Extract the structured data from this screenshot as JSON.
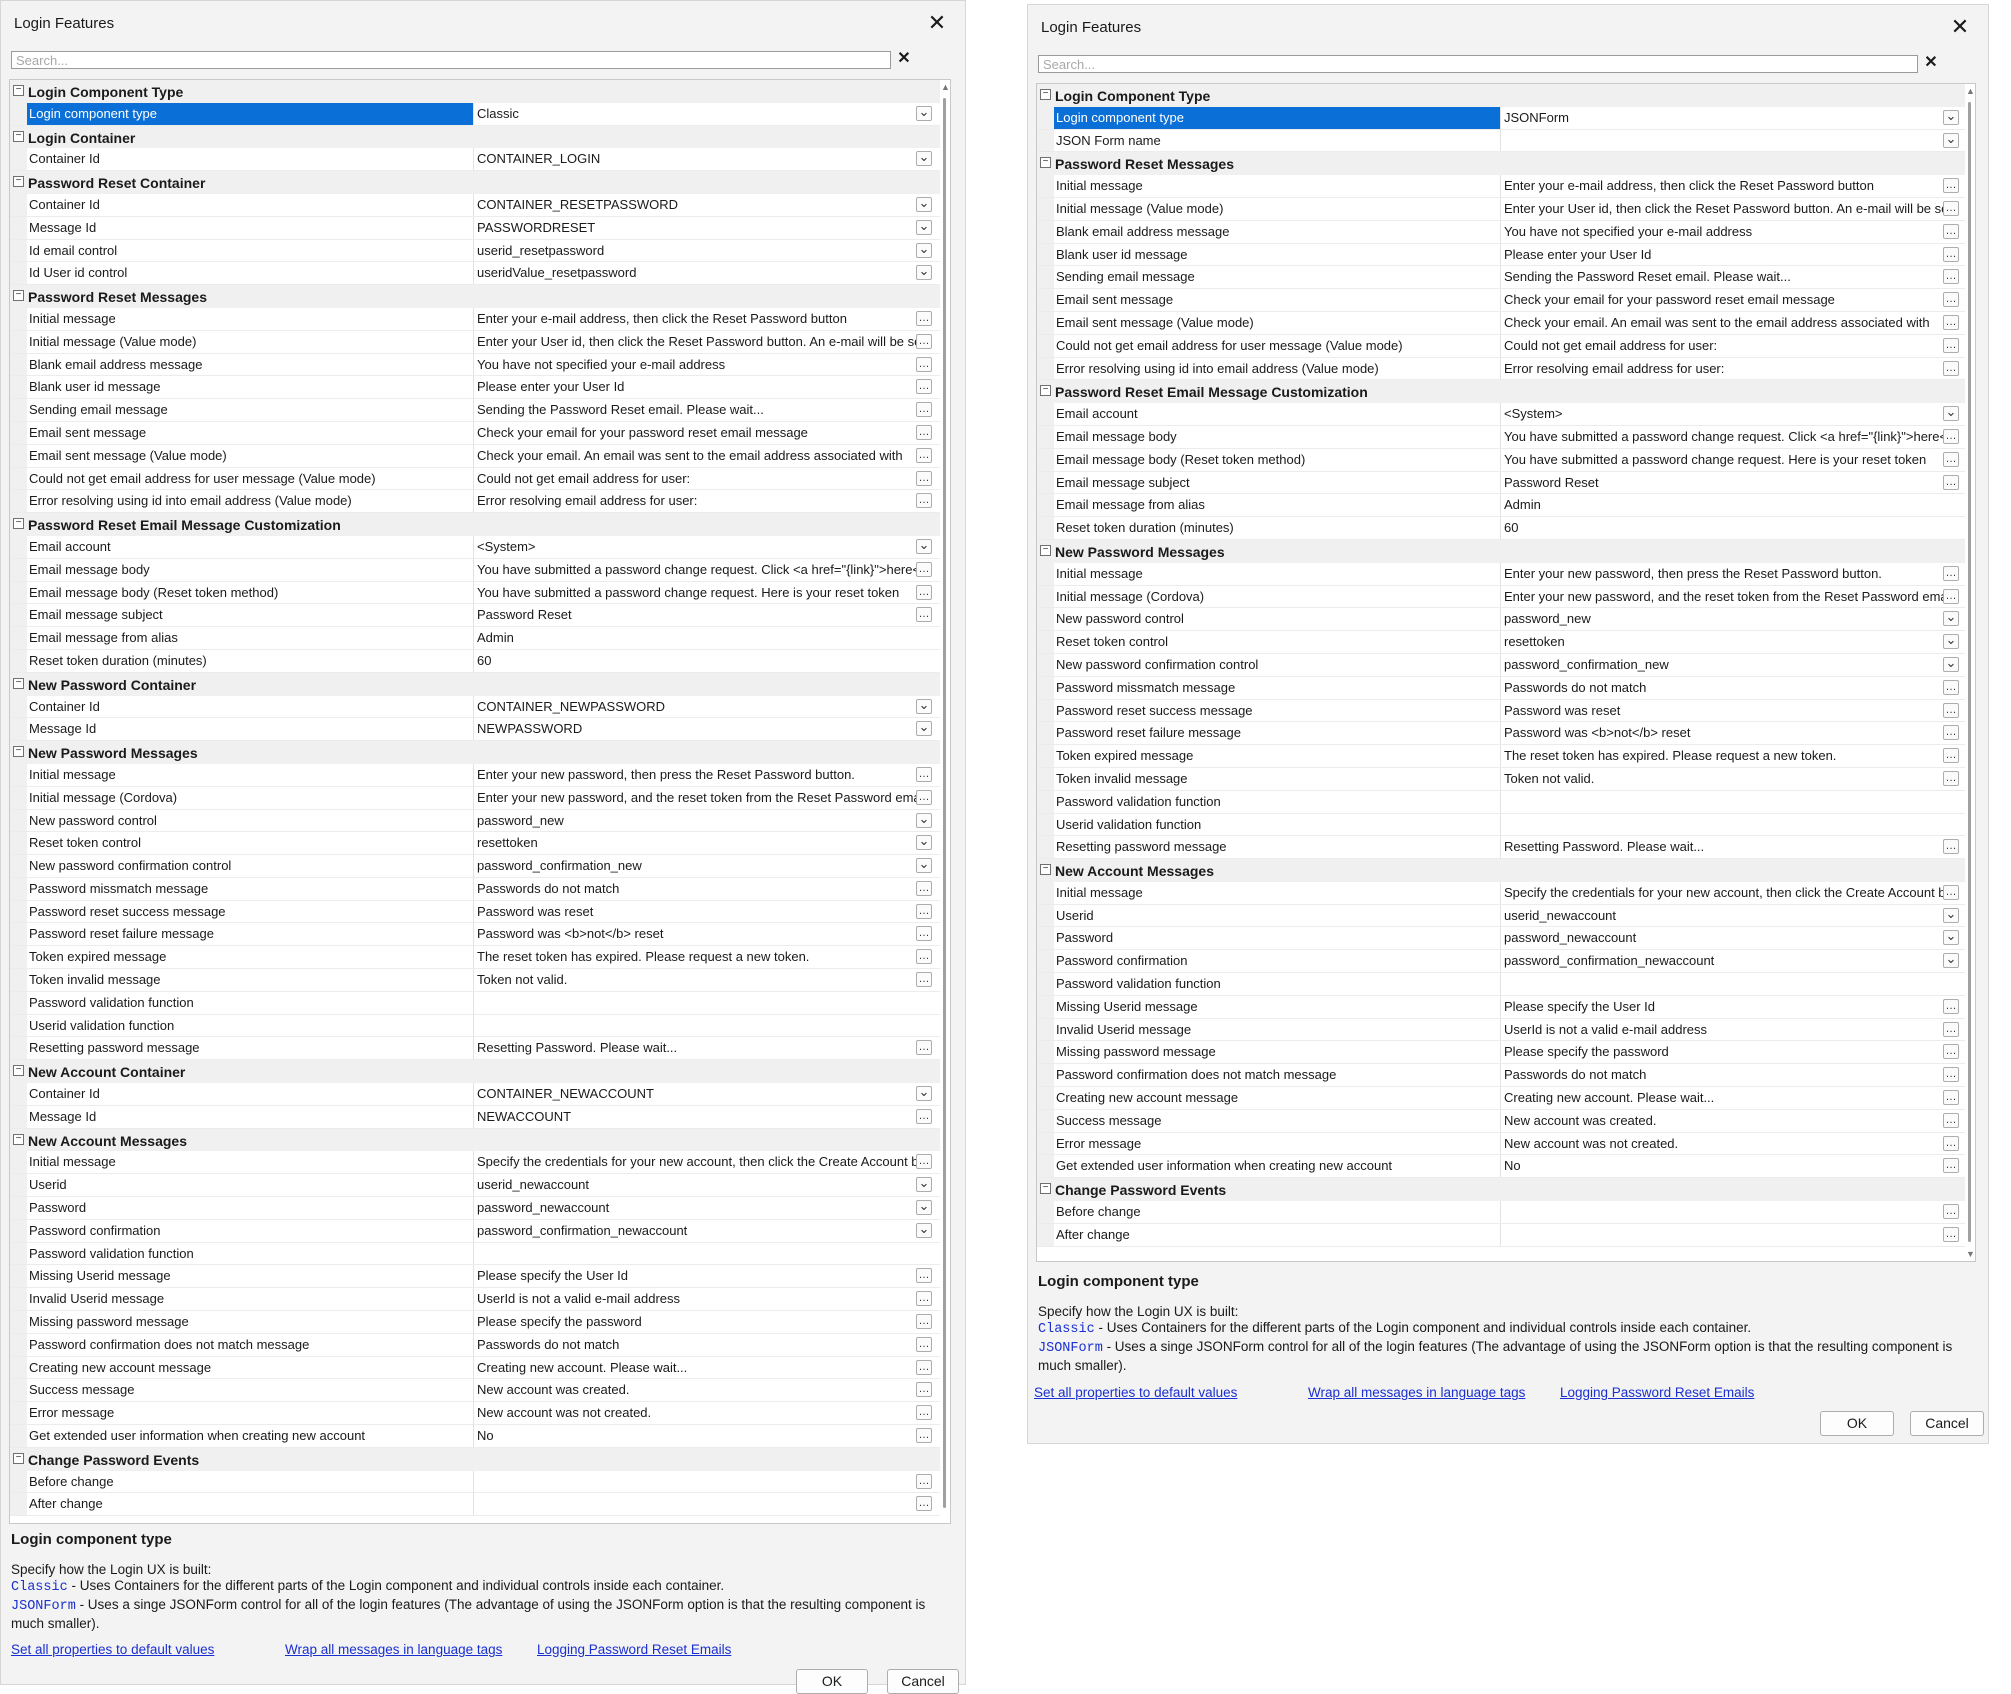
{
  "left": {
    "window_title": "Login Features",
    "search_placeholder": "Search...",
    "rows": [
      {
        "t": "c",
        "label": "Login Component Type"
      },
      {
        "t": "p",
        "name": "Login component type",
        "value": "Classic",
        "btn": "dd",
        "sel": true
      },
      {
        "t": "c",
        "label": "Login Container"
      },
      {
        "t": "p",
        "name": "Container Id",
        "value": "CONTAINER_LOGIN",
        "btn": "dd"
      },
      {
        "t": "c",
        "label": "Password Reset Container"
      },
      {
        "t": "p",
        "name": "Container Id",
        "value": "CONTAINER_RESETPASSWORD",
        "btn": "dd"
      },
      {
        "t": "p",
        "name": "Message Id",
        "value": "PASSWORDRESET",
        "btn": "dd"
      },
      {
        "t": "p",
        "name": "Id email control",
        "value": "userid_resetpassword",
        "btn": "dd"
      },
      {
        "t": "p",
        "name": "Id User id control",
        "value": "useridValue_resetpassword",
        "btn": "dd"
      },
      {
        "t": "c",
        "label": "Password Reset Messages"
      },
      {
        "t": "p",
        "name": "Initial message",
        "value": "Enter your e-mail address, then click the Reset Password button",
        "btn": "el"
      },
      {
        "t": "p",
        "name": "Initial message (Value mode)",
        "value": "Enter your User id, then click the Reset Password button. An e-mail will be sent",
        "btn": "el"
      },
      {
        "t": "p",
        "name": "Blank email address message",
        "value": "You have not specified your e-mail address",
        "btn": "el"
      },
      {
        "t": "p",
        "name": "Blank user id message",
        "value": "Please enter your User Id",
        "btn": "el"
      },
      {
        "t": "p",
        "name": "Sending email message",
        "value": "Sending the Password Reset email. Please wait...",
        "btn": "el"
      },
      {
        "t": "p",
        "name": "Email sent message",
        "value": "Check your email for your password reset email message",
        "btn": "el"
      },
      {
        "t": "p",
        "name": "Email sent message (Value mode)",
        "value": "Check your email. An email was sent to the email address associated with",
        "btn": "el"
      },
      {
        "t": "p",
        "name": "Could not get email address for user message (Value mode)",
        "value": "Could not get email address for user:",
        "btn": "el"
      },
      {
        "t": "p",
        "name": "Error resolving using id into email address (Value mode)",
        "value": "Error resolving email address for user:",
        "btn": "el"
      },
      {
        "t": "c",
        "label": "Password Reset Email Message Customization"
      },
      {
        "t": "p",
        "name": "Email account",
        "value": "<System>",
        "btn": "dd"
      },
      {
        "t": "p",
        "name": "Email message body",
        "value": "You have submitted a password change request. Click <a href=\"{link}\">here</a>",
        "btn": "el"
      },
      {
        "t": "p",
        "name": "Email message body (Reset token method)",
        "value": "You have submitted a password change request. Here is your reset token",
        "btn": "el"
      },
      {
        "t": "p",
        "name": "Email message subject",
        "value": "Password Reset",
        "btn": "el"
      },
      {
        "t": "p",
        "name": "Email message from alias",
        "value": "Admin",
        "btn": ""
      },
      {
        "t": "p",
        "name": "Reset token duration (minutes)",
        "value": "60",
        "btn": ""
      },
      {
        "t": "c",
        "label": "New Password Container"
      },
      {
        "t": "p",
        "name": "Container Id",
        "value": "CONTAINER_NEWPASSWORD",
        "btn": "dd"
      },
      {
        "t": "p",
        "name": "Message Id",
        "value": "NEWPASSWORD",
        "btn": "dd"
      },
      {
        "t": "c",
        "label": "New Password Messages"
      },
      {
        "t": "p",
        "name": "Initial message",
        "value": "Enter your new password, then press the Reset Password button.",
        "btn": "el"
      },
      {
        "t": "p",
        "name": "Initial message (Cordova)",
        "value": "Enter your new password, and the reset token from the Reset Password email",
        "btn": "el"
      },
      {
        "t": "p",
        "name": "New password control",
        "value": "password_new",
        "btn": "dd"
      },
      {
        "t": "p",
        "name": "Reset token control",
        "value": "resettoken",
        "btn": "dd"
      },
      {
        "t": "p",
        "name": "New password confirmation control",
        "value": "password_confirmation_new",
        "btn": "dd"
      },
      {
        "t": "p",
        "name": "Password missmatch message",
        "value": "Passwords do not match",
        "btn": "el"
      },
      {
        "t": "p",
        "name": "Password reset success message",
        "value": "Password was reset",
        "btn": "el"
      },
      {
        "t": "p",
        "name": "Password reset failure message",
        "value": "Password was <b>not</b> reset",
        "btn": "el"
      },
      {
        "t": "p",
        "name": "Token expired message",
        "value": "The reset token has expired. Please request a new token.",
        "btn": "el"
      },
      {
        "t": "p",
        "name": "Token invalid message",
        "value": "Token not valid.",
        "btn": "el"
      },
      {
        "t": "p",
        "name": "Password validation function",
        "value": "",
        "btn": ""
      },
      {
        "t": "p",
        "name": "Userid validation function",
        "value": "",
        "btn": ""
      },
      {
        "t": "p",
        "name": "Resetting password message",
        "value": "Resetting Password. Please wait...",
        "btn": "el"
      },
      {
        "t": "c",
        "label": "New Account Container"
      },
      {
        "t": "p",
        "name": "Container Id",
        "value": "CONTAINER_NEWACCOUNT",
        "btn": "dd"
      },
      {
        "t": "p",
        "name": "Message Id",
        "value": "NEWACCOUNT",
        "btn": "el"
      },
      {
        "t": "c",
        "label": "New Account Messages"
      },
      {
        "t": "p",
        "name": "Initial message",
        "value": "Specify the credentials for your new account, then click the Create Account button",
        "btn": "el"
      },
      {
        "t": "p",
        "name": "Userid",
        "value": "userid_newaccount",
        "btn": "dd"
      },
      {
        "t": "p",
        "name": "Password",
        "value": "password_newaccount",
        "btn": "dd"
      },
      {
        "t": "p",
        "name": "Password confirmation",
        "value": "password_confirmation_newaccount",
        "btn": "dd"
      },
      {
        "t": "p",
        "name": "Password validation function",
        "value": "",
        "btn": ""
      },
      {
        "t": "p",
        "name": "Missing Userid message",
        "value": "Please specify the User Id",
        "btn": "el"
      },
      {
        "t": "p",
        "name": "Invalid Userid message",
        "value": "UserId is not a valid e-mail address",
        "btn": "el"
      },
      {
        "t": "p",
        "name": "Missing password message",
        "value": "Please specify the password",
        "btn": "el"
      },
      {
        "t": "p",
        "name": "Password confirmation does not match message",
        "value": "Passwords do not match",
        "btn": "el"
      },
      {
        "t": "p",
        "name": "Creating new account message",
        "value": "Creating new account. Please wait...",
        "btn": "el"
      },
      {
        "t": "p",
        "name": "Success message",
        "value": "New account was created.",
        "btn": "el"
      },
      {
        "t": "p",
        "name": "Error message",
        "value": "New account was not created.",
        "btn": "el"
      },
      {
        "t": "p",
        "name": "Get extended user information when creating new account",
        "value": "No",
        "btn": "el"
      },
      {
        "t": "c",
        "label": "Change Password Events"
      },
      {
        "t": "p",
        "name": "Before change",
        "value": "",
        "btn": "el"
      },
      {
        "t": "p",
        "name": "After change",
        "value": "",
        "btn": "el"
      }
    ],
    "help": {
      "title": "Login component type",
      "intro": "Specify how the Login UX is built:",
      "classic_code": "Classic",
      "classic_text": " - Uses Containers for the different parts of the Login component and individual controls inside each container.",
      "json_code": "JSONForm",
      "json_text": " - Uses a singe JSONForm control for all of the login features (The advantage of using the JSONForm option is that the resulting component is much smaller)."
    },
    "links": [
      "Set all properties to default values",
      "Wrap all messages in language tags",
      "Logging Password Reset Emails"
    ],
    "ok_label": "OK",
    "cancel_label": "Cancel"
  },
  "right": {
    "window_title": "Login Features",
    "search_placeholder": "Search...",
    "rows": [
      {
        "t": "c",
        "label": "Login Component Type"
      },
      {
        "t": "p",
        "name": "Login component type",
        "value": "JSONForm",
        "btn": "dd",
        "sel": true
      },
      {
        "t": "p",
        "name": "JSON Form name",
        "value": "",
        "btn": "dd"
      },
      {
        "t": "c",
        "label": "Password Reset Messages"
      },
      {
        "t": "p",
        "name": "Initial message",
        "value": "Enter your e-mail address, then click the Reset Password button",
        "btn": "el"
      },
      {
        "t": "p",
        "name": "Initial message (Value mode)",
        "value": "Enter your User id, then click the Reset Password button. An e-mail will be sent",
        "btn": "el"
      },
      {
        "t": "p",
        "name": "Blank email address message",
        "value": "You have not specified your e-mail address",
        "btn": "el"
      },
      {
        "t": "p",
        "name": "Blank user id message",
        "value": "Please enter your User Id",
        "btn": "el"
      },
      {
        "t": "p",
        "name": "Sending email message",
        "value": "Sending the Password Reset email. Please wait...",
        "btn": "el"
      },
      {
        "t": "p",
        "name": "Email sent message",
        "value": "Check your email for your password reset email message",
        "btn": "el"
      },
      {
        "t": "p",
        "name": "Email sent message (Value mode)",
        "value": "Check your email. An email was sent to the email address associated with",
        "btn": "el"
      },
      {
        "t": "p",
        "name": "Could not get email address for user message (Value mode)",
        "value": "Could not get email address for user:",
        "btn": "el"
      },
      {
        "t": "p",
        "name": "Error resolving using id into email address (Value mode)",
        "value": "Error resolving email address for user:",
        "btn": "el"
      },
      {
        "t": "c",
        "label": "Password Reset Email Message Customization"
      },
      {
        "t": "p",
        "name": "Email account",
        "value": "<System>",
        "btn": "dd"
      },
      {
        "t": "p",
        "name": "Email message body",
        "value": "You have submitted a password change request. Click <a href=\"{link}\">here</a>",
        "btn": "el"
      },
      {
        "t": "p",
        "name": "Email message body (Reset token method)",
        "value": "You have submitted a password change request. Here is your reset token",
        "btn": "el"
      },
      {
        "t": "p",
        "name": "Email message subject",
        "value": "Password Reset",
        "btn": "el"
      },
      {
        "t": "p",
        "name": "Email message from alias",
        "value": "Admin",
        "btn": ""
      },
      {
        "t": "p",
        "name": "Reset token duration (minutes)",
        "value": "60",
        "btn": ""
      },
      {
        "t": "c",
        "label": "New Password Messages"
      },
      {
        "t": "p",
        "name": "Initial message",
        "value": "Enter your new password, then press the Reset Password button.",
        "btn": "el"
      },
      {
        "t": "p",
        "name": "Initial message (Cordova)",
        "value": "Enter your new password, and the reset token from the Reset Password email",
        "btn": "el"
      },
      {
        "t": "p",
        "name": "New password control",
        "value": "password_new",
        "btn": "dd"
      },
      {
        "t": "p",
        "name": "Reset token control",
        "value": "resettoken",
        "btn": "dd"
      },
      {
        "t": "p",
        "name": "New password confirmation control",
        "value": "password_confirmation_new",
        "btn": "dd"
      },
      {
        "t": "p",
        "name": "Password missmatch message",
        "value": "Passwords do not match",
        "btn": "el"
      },
      {
        "t": "p",
        "name": "Password reset success message",
        "value": "Password was reset",
        "btn": "el"
      },
      {
        "t": "p",
        "name": "Password reset failure message",
        "value": "Password was <b>not</b> reset",
        "btn": "el"
      },
      {
        "t": "p",
        "name": "Token expired message",
        "value": "The reset token has expired. Please request a new token.",
        "btn": "el"
      },
      {
        "t": "p",
        "name": "Token invalid message",
        "value": "Token not valid.",
        "btn": "el"
      },
      {
        "t": "p",
        "name": "Password validation function",
        "value": "",
        "btn": ""
      },
      {
        "t": "p",
        "name": "Userid validation function",
        "value": "",
        "btn": ""
      },
      {
        "t": "p",
        "name": "Resetting password message",
        "value": "Resetting Password. Please wait...",
        "btn": "el"
      },
      {
        "t": "c",
        "label": "New Account Messages"
      },
      {
        "t": "p",
        "name": "Initial message",
        "value": "Specify the credentials for your new account, then click the Create Account button",
        "btn": "el"
      },
      {
        "t": "p",
        "name": "Userid",
        "value": "userid_newaccount",
        "btn": "dd"
      },
      {
        "t": "p",
        "name": "Password",
        "value": "password_newaccount",
        "btn": "dd"
      },
      {
        "t": "p",
        "name": "Password confirmation",
        "value": "password_confirmation_newaccount",
        "btn": "dd"
      },
      {
        "t": "p",
        "name": "Password validation function",
        "value": "",
        "btn": ""
      },
      {
        "t": "p",
        "name": "Missing Userid message",
        "value": "Please specify the User Id",
        "btn": "el"
      },
      {
        "t": "p",
        "name": "Invalid Userid message",
        "value": "UserId is not a valid e-mail address",
        "btn": "el"
      },
      {
        "t": "p",
        "name": "Missing password message",
        "value": "Please specify the password",
        "btn": "el"
      },
      {
        "t": "p",
        "name": "Password confirmation does not match message",
        "value": "Passwords do not match",
        "btn": "el"
      },
      {
        "t": "p",
        "name": "Creating new account message",
        "value": "Creating new account. Please wait...",
        "btn": "el"
      },
      {
        "t": "p",
        "name": "Success message",
        "value": "New account was created.",
        "btn": "el"
      },
      {
        "t": "p",
        "name": "Error message",
        "value": "New account was not created.",
        "btn": "el"
      },
      {
        "t": "p",
        "name": "Get extended user information when creating new account",
        "value": "No",
        "btn": "el"
      },
      {
        "t": "c",
        "label": "Change Password Events"
      },
      {
        "t": "p",
        "name": "Before change",
        "value": "",
        "btn": "el"
      },
      {
        "t": "p",
        "name": "After change",
        "value": "",
        "btn": "el"
      }
    ],
    "help": {
      "title": "Login component type",
      "intro": "Specify how the Login UX is built:",
      "classic_code": "Classic",
      "classic_text": " - Uses Containers for the different parts of the Login component and individual controls inside each container.",
      "json_code": "JSONForm",
      "json_text": " - Uses a singe JSONForm control for all of the login features (The advantage of using the JSONForm option is that the resulting component is much smaller)."
    },
    "links": [
      "Set all properties to default values",
      "Wrap all messages in language tags",
      "Logging Password Reset Emails"
    ],
    "ok_label": "OK",
    "cancel_label": "Cancel"
  },
  "icons": {
    "collapse": "minus-box-icon",
    "dropdown": "chevron-down-icon",
    "ellipsis": "ellipsis-icon",
    "close": "close-icon",
    "clear": "clear-search-icon"
  }
}
